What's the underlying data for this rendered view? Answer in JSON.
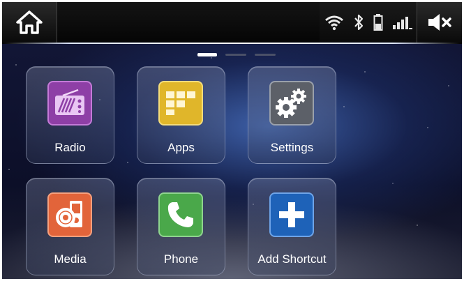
{
  "top_bar": {
    "home_icon": "home-icon",
    "status_icons": [
      "wifi-icon",
      "bluetooth-icon",
      "battery-icon",
      "signal-icon"
    ],
    "mute_icon": "speaker-muted-icon"
  },
  "pager": {
    "pages": 3,
    "active": 1
  },
  "tiles": [
    {
      "label": "Radio",
      "icon": "radio-icon",
      "color": "#8e3fa6"
    },
    {
      "label": "Apps",
      "icon": "apps-grid-icon",
      "color": "#e0b62a"
    },
    {
      "label": "Settings",
      "icon": "gears-icon",
      "color": "#5c6068"
    },
    {
      "label": "Media",
      "icon": "media-icon",
      "color": "#e2643a"
    },
    {
      "label": "Phone",
      "icon": "phone-icon",
      "color": "#4aa84a"
    },
    {
      "label": "Add Shortcut",
      "icon": "plus-icon",
      "color": "#1e62b8"
    }
  ]
}
